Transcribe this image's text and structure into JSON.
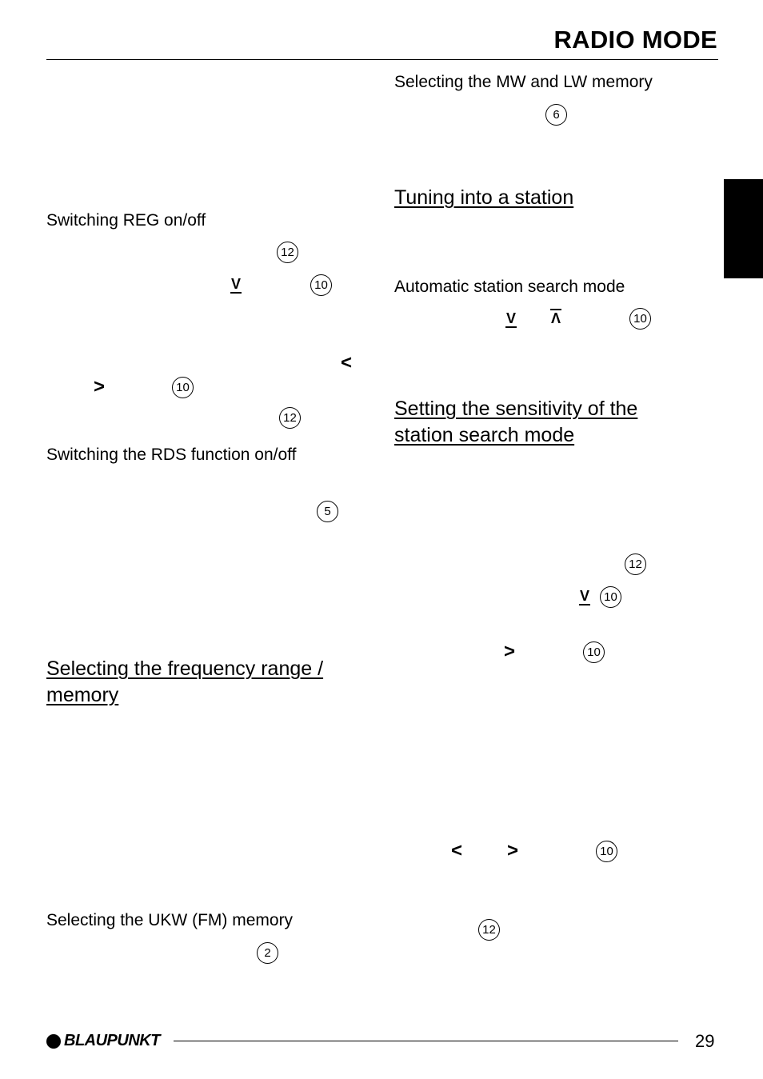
{
  "header": {
    "title": "RADIO MODE"
  },
  "left_column": {
    "reg": {
      "heading": "Switching REG on/off",
      "markers": [
        "12",
        "10",
        "10",
        "12"
      ],
      "arrows": [
        "v",
        "<",
        ">"
      ]
    },
    "rds": {
      "heading": "Switching the RDS function on/off",
      "markers": [
        "5"
      ]
    },
    "freq": {
      "heading_line1": "Selecting the frequency range /",
      "heading_line2": "memory"
    },
    "ukw": {
      "heading": "Selecting the UKW (FM) memory",
      "markers": [
        "2"
      ]
    }
  },
  "right_column": {
    "mwlw": {
      "heading": "Selecting the MW and LW memory",
      "markers": [
        "6"
      ]
    },
    "tuning": {
      "heading": "Tuning into a station"
    },
    "auto": {
      "heading": "Automatic station search mode",
      "arrows": [
        "v",
        "^"
      ],
      "markers": [
        "10"
      ]
    },
    "sensitivity": {
      "heading_line1": "Setting the sensitivity of the",
      "heading_line2": "station search mode",
      "markers": [
        "12",
        "10",
        "10",
        "10",
        "12"
      ],
      "arrows": [
        "v",
        ">",
        "<",
        ">"
      ]
    }
  },
  "footer": {
    "brand": "BLAUPUNKT",
    "page_number": "29"
  }
}
